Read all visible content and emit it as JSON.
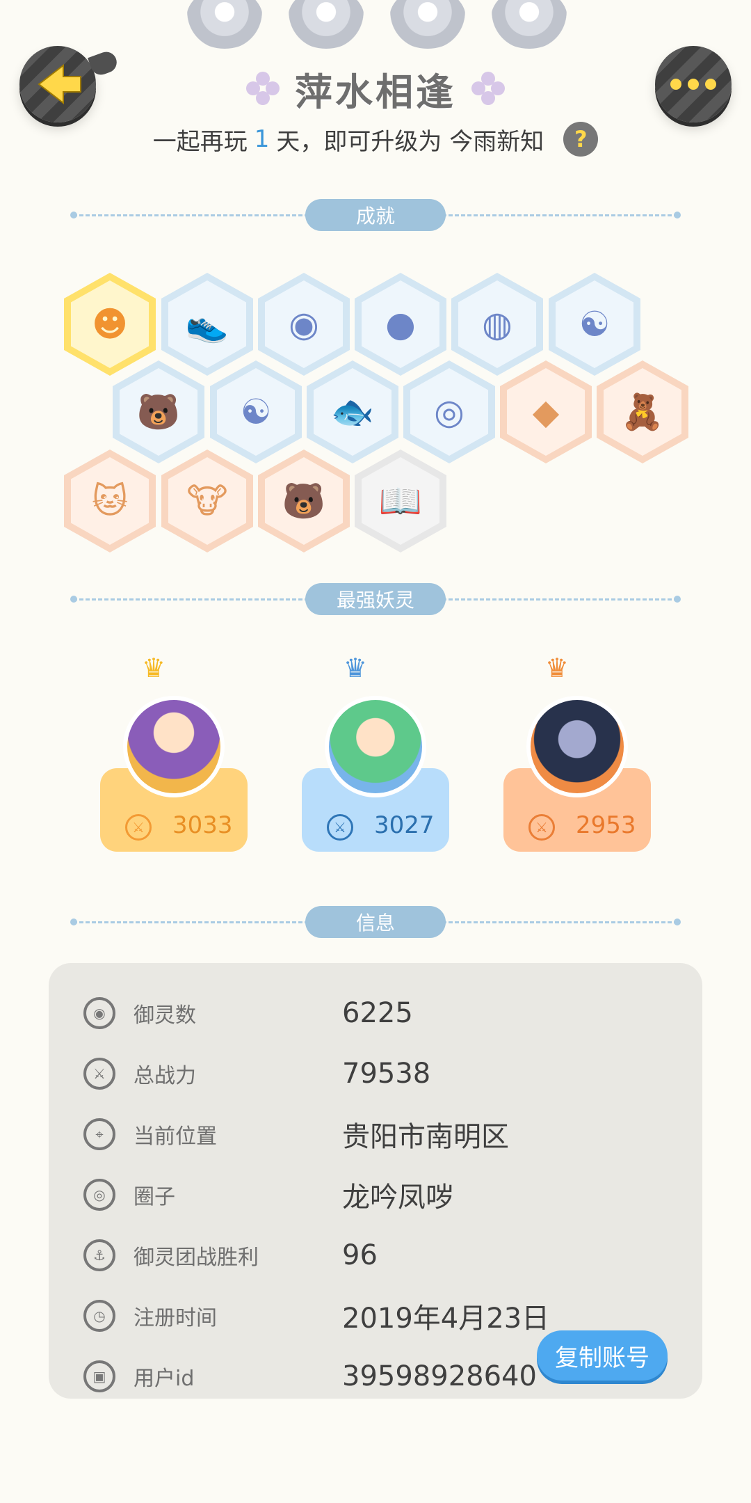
{
  "header": {
    "title": "萍水相逢",
    "subtitle": {
      "prefix": "一起再玩",
      "days": "1",
      "suffix": "天，即可升级为 今雨新知"
    },
    "help_icon": "?"
  },
  "sections": {
    "achievements": "成就",
    "strongest_spirits": "最强妖灵",
    "info": "信息"
  },
  "achievements": [
    {
      "icon": "☻",
      "tone": "gold"
    },
    {
      "icon": "👟",
      "tone": "blue"
    },
    {
      "icon": "◉",
      "tone": "blue"
    },
    {
      "icon": "●",
      "tone": "blue"
    },
    {
      "icon": "◍",
      "tone": "blue"
    },
    {
      "icon": "☯",
      "tone": "blue"
    },
    {
      "icon": "🐻",
      "tone": "blue"
    },
    {
      "icon": "☯",
      "tone": "blue"
    },
    {
      "icon": "🐟",
      "tone": "blue"
    },
    {
      "icon": "◎",
      "tone": "blue"
    },
    {
      "icon": "◆",
      "tone": "orange"
    },
    {
      "icon": "🧸",
      "tone": "orange"
    },
    {
      "icon": "🐱",
      "tone": "orange"
    },
    {
      "icon": "🐮",
      "tone": "orange"
    },
    {
      "icon": "🐻",
      "tone": "orange"
    },
    {
      "icon": "📖",
      "tone": "gray"
    }
  ],
  "spirits": [
    {
      "power": "3033",
      "tone": "gold"
    },
    {
      "power": "3027",
      "tone": "blue"
    },
    {
      "power": "2953",
      "tone": "orange"
    }
  ],
  "info": [
    {
      "label": "御灵数",
      "value": "6225",
      "icon": "spirit-count-icon"
    },
    {
      "label": "总战力",
      "value": "79538",
      "icon": "total-power-icon"
    },
    {
      "label": "当前位置",
      "value": "贵阳市南明区",
      "icon": "location-icon"
    },
    {
      "label": "圈子",
      "value": "龙吟凤哕",
      "icon": "circle-icon"
    },
    {
      "label": "御灵团战胜利",
      "value": "96",
      "icon": "team-battle-icon"
    },
    {
      "label": "注册时间",
      "value": "2019年4月23日",
      "icon": "clock-icon"
    },
    {
      "label": "用户id",
      "value": "39598928640",
      "icon": "id-icon"
    }
  ],
  "actions": {
    "copy_account": "复制账号"
  }
}
